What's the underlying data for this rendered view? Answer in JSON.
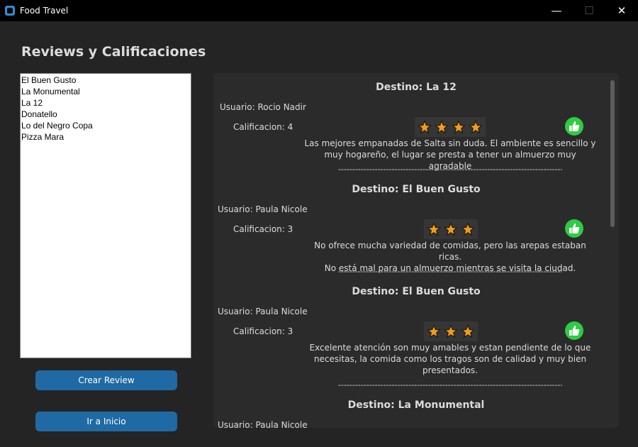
{
  "window": {
    "title": "Food Travel"
  },
  "page": {
    "heading": "Reviews y Calificaciones"
  },
  "restaurants": [
    "El Buen Gusto",
    "La Monumental",
    "La 12",
    "Donatello",
    "Lo del Negro Copa",
    "Pizza Mara"
  ],
  "buttons": {
    "create_review": "Crear Review",
    "go_home": "Ir a Inicio"
  },
  "reviews": [
    {
      "destino": "Destino: La 12",
      "usuario": "Usuario: Rocio Nadir",
      "calificacion": "Calificacion: 4",
      "stars": 4,
      "comment_lines": [
        "Las mejores empanadas de Salta sin duda. El ambiente es sencillo y",
        "muy hogareño, el lugar se presta a tener un almuerzo muy agradable"
      ],
      "separator": "------------------------------------------------------------------------------------"
    },
    {
      "destino": "Destino: El Buen Gusto",
      "usuario": "Usuario: Paula Nicole",
      "calificacion": "Calificacion: 3",
      "stars": 3,
      "comment_lines": [
        "No ofrece mucha variedad de comidas, pero las arepas estaban ricas.",
        "No está mal para un almuerzo mientras se visita la ciudad."
      ],
      "separator": "------------------------------------------------------------------------------------"
    },
    {
      "destino": "Destino: El Buen Gusto",
      "usuario": "Usuario: Paula Nicole",
      "calificacion": "Calificacion: 3",
      "stars": 3,
      "comment_lines": [
        "Excelente atención son muy amables y estan pendiente de lo que",
        "necesitas, la comida como los tragos son de calidad y muy bien",
        "presentados."
      ],
      "separator": "------------------------------------------------------------------------------------"
    },
    {
      "destino": "Destino: La Monumental",
      "usuario": "Usuario: Paula Nicole"
    }
  ],
  "colors": {
    "accent": "#1f6aa5",
    "star": "#f39c12",
    "thumb": "#2fcc43"
  }
}
